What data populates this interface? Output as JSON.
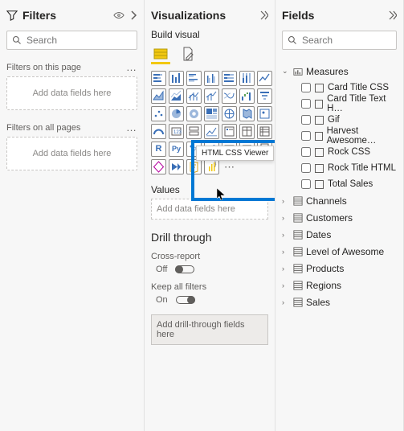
{
  "filters": {
    "title": "Filters",
    "search_ph": "Search",
    "page_label": "Filters on this page",
    "allpages_label": "Filters on all pages",
    "drop": "Add data fields here"
  },
  "viz": {
    "title": "Visualizations",
    "build": "Build visual",
    "tooltip": "HTML CSS Viewer",
    "values": "Values",
    "values_drop": "Add data fields here",
    "drill": "Drill through",
    "cross": "Cross-report",
    "off": "Off",
    "keep": "Keep all filters",
    "on": "On",
    "drill_drop": "Add drill-through fields here"
  },
  "fields": {
    "title": "Fields",
    "search_ph": "Search",
    "tables": [
      {
        "name": "Measures",
        "open": true,
        "items": [
          "Card Title CSS",
          "Card Title Text H…",
          "Gif",
          "Harvest Awesome…",
          "Rock CSS",
          "Rock Title HTML",
          "Total Sales"
        ]
      },
      {
        "name": "Channels",
        "open": false
      },
      {
        "name": "Customers",
        "open": false
      },
      {
        "name": "Dates",
        "open": false
      },
      {
        "name": "Level of Awesome",
        "open": false
      },
      {
        "name": "Products",
        "open": false
      },
      {
        "name": "Regions",
        "open": false
      },
      {
        "name": "Sales",
        "open": false
      }
    ]
  }
}
